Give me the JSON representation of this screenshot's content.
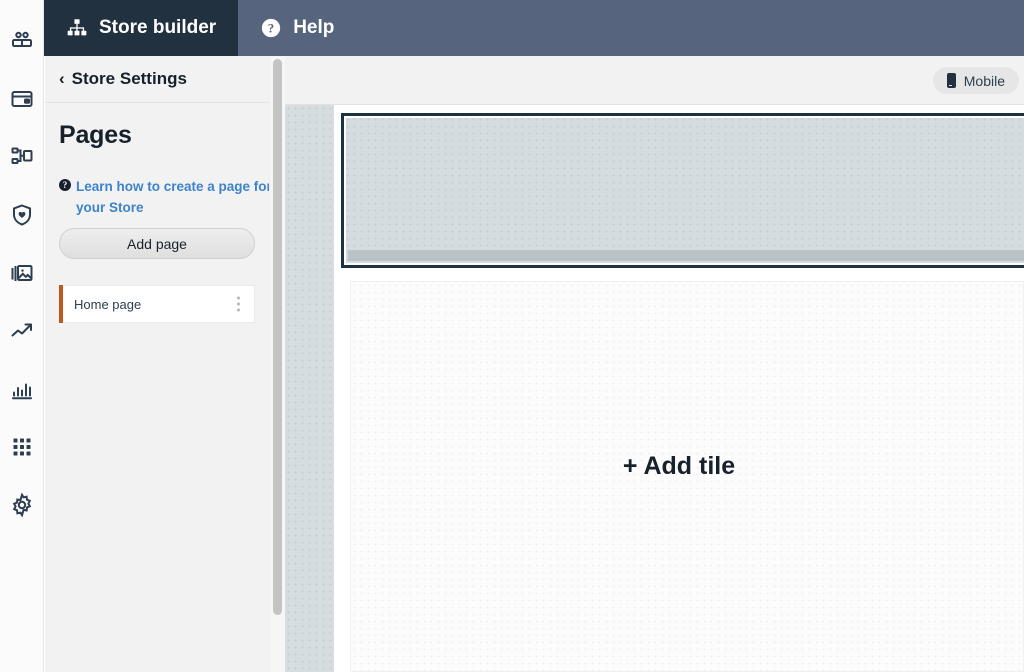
{
  "header": {
    "tabs": [
      {
        "label": "Store builder",
        "icon": "sitemap-icon",
        "active": true
      },
      {
        "label": "Help",
        "icon": "question-circle-icon",
        "active": false
      }
    ]
  },
  "icon_rail": {
    "items": [
      {
        "icon": "users-icon",
        "name": "customers"
      },
      {
        "icon": "credit-card-icon",
        "name": "payments"
      },
      {
        "icon": "sitemap-icon",
        "name": "structure"
      },
      {
        "icon": "shield-heart-icon",
        "name": "protection"
      },
      {
        "icon": "gallery-icon",
        "name": "media"
      },
      {
        "icon": "trending-up-icon",
        "name": "growth"
      },
      {
        "icon": "bar-chart-icon",
        "name": "reports"
      },
      {
        "icon": "grid-apps-icon",
        "name": "apps"
      },
      {
        "icon": "gear-icon",
        "name": "settings"
      }
    ]
  },
  "panel": {
    "back_label": "Store Settings",
    "back_chevron": "‹",
    "title": "Pages",
    "learn_link": "Learn how to create a page for your Store",
    "help_glyph": "?",
    "add_page_label": "Add page",
    "pages": [
      {
        "label": "Home page",
        "accent_color": "#c0571f",
        "selected": true
      }
    ]
  },
  "canvas": {
    "device_toggle": {
      "label": "Mobile",
      "icon": "phone-icon"
    },
    "add_tile_label": "+ Add tile"
  },
  "colors": {
    "header_bg": "#56657d",
    "header_active_tab": "#22313f",
    "panel_bg": "#f2f2f2",
    "link_blue": "#3d83cc",
    "accent_orange": "#c0571f",
    "navy_text": "#17212b",
    "stage_bg": "#d5dde0",
    "banner_border": "#1b3340",
    "banner_fill": "#d5dcdf"
  }
}
